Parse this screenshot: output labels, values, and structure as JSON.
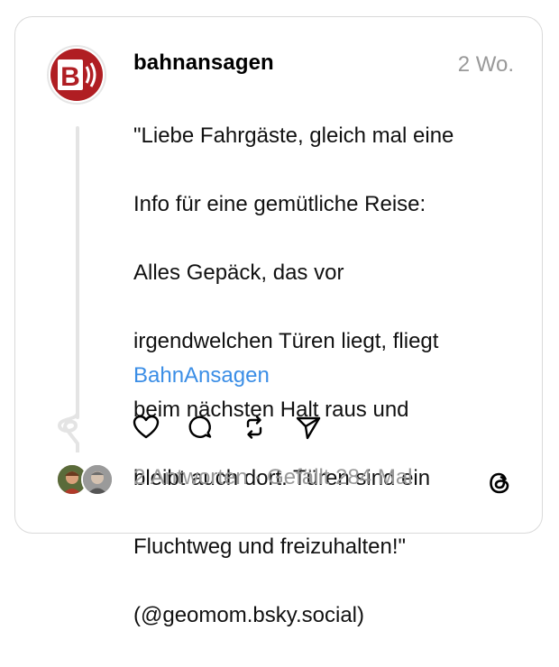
{
  "post": {
    "username": "bahnansagen",
    "timestamp": "2 Wo.",
    "text_lines": [
      "\"Liebe Fahrgäste, gleich mal eine",
      "Info für eine gemütliche Reise:",
      "Alles Gepäck, das vor",
      "irgendwelchen Türen liegt, fliegt",
      "beim nächsten Halt raus und",
      "bleibt auch dort. Türen sind ein",
      "Fluchtweg und freizuhalten!\"",
      "(@geomom.bsky.social)"
    ],
    "link": "BahnAnsagen",
    "avatar_letter": "B"
  },
  "stats": {
    "replies": "2 Antworten",
    "separator": " · ",
    "likes": "Gefällt 284 Mal"
  },
  "icons": {
    "like": "heart-icon",
    "reply": "comment-icon",
    "repost": "repost-icon",
    "share": "send-icon",
    "app": "threads-logo-icon"
  },
  "colors": {
    "brand_red": "#b01e23",
    "link": "#3b8ee6",
    "muted": "#999999"
  }
}
